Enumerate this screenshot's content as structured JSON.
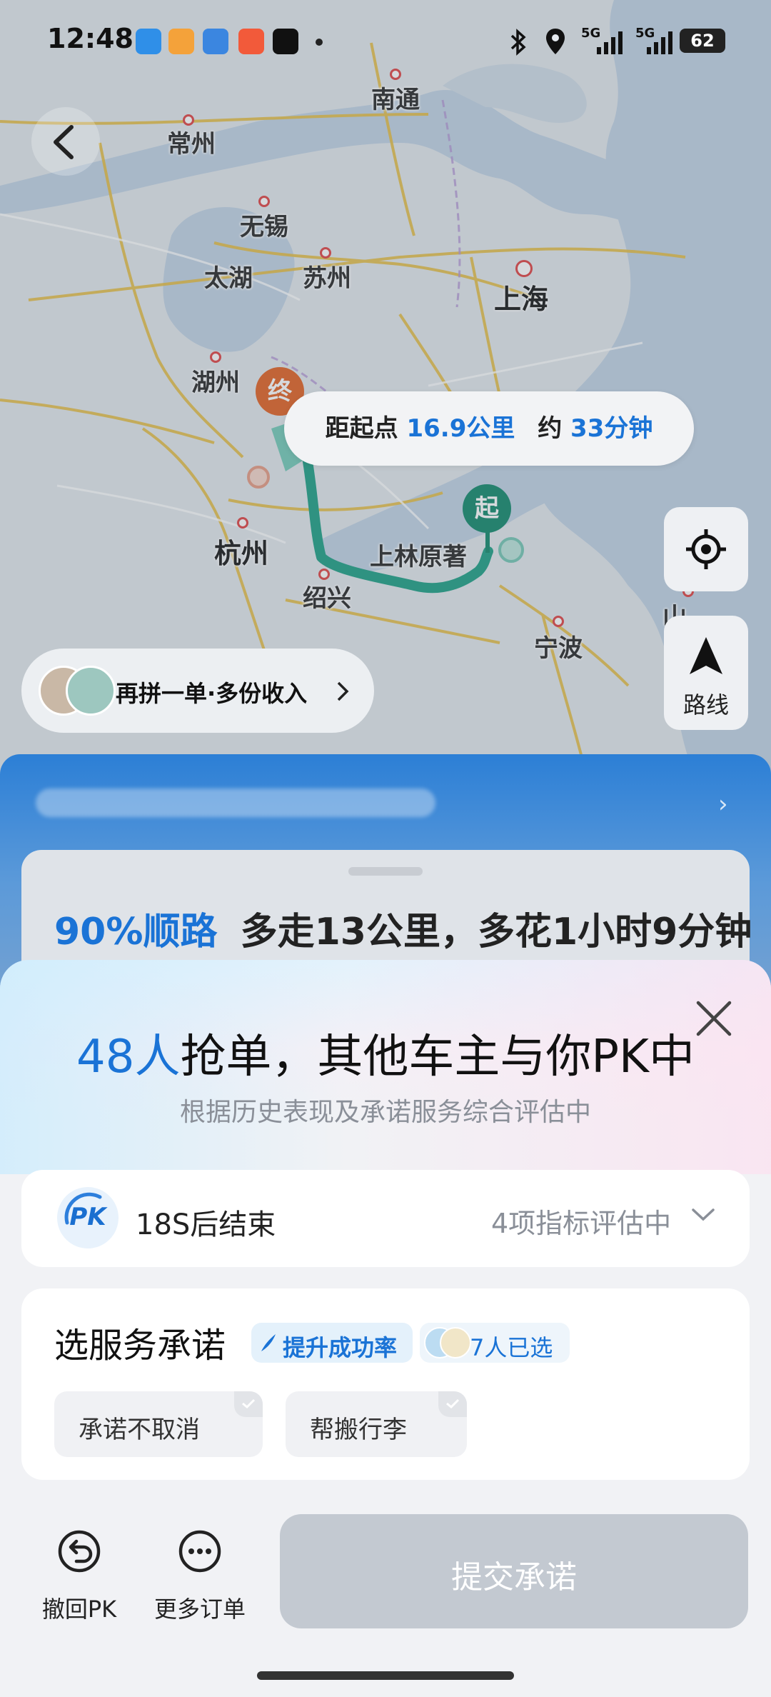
{
  "status_bar": {
    "time": "12:48",
    "signal_1": "5G",
    "signal_2": "5G",
    "battery": "62",
    "icons": [
      "app-icon-hitch",
      "app-icon-orange",
      "app-icon-cloud",
      "app-icon-red",
      "tiktok-icon",
      "bluetooth-icon",
      "location-icon"
    ]
  },
  "map": {
    "cities": {
      "nantong": "南通",
      "changzhou": "常州",
      "wuxi": "无锡",
      "taihu": "太湖",
      "suzhou": "苏州",
      "shanghai": "上海",
      "huzhou": "湖州",
      "hangzhou": "杭州",
      "shaoxing": "绍兴",
      "ningbo": "宁波",
      "origin_place": "上林原著",
      "edge_label": "山"
    },
    "end_marker": "终",
    "start_marker": "起",
    "distance": {
      "prefix": "距起点",
      "km": "16.9公里",
      "about": "约",
      "minutes": "33分钟"
    },
    "route_button_label": "路线",
    "carpool_label": "再拼一单·多份收入",
    "colors": {
      "route": "#2aa58b",
      "start": "#1e8f73",
      "end": "#e56a2e",
      "accent": "#1a73d6"
    }
  },
  "detour": {
    "percent": "90%顺路",
    "detail": "多走13公里，多花1小时9分钟"
  },
  "pk_sheet": {
    "count": "48人",
    "title_rest": "抢单，其他车主与你PK中",
    "subtitle": "根据历史表现及承诺服务综合评估中",
    "pk_badge": "PK",
    "timer": "18S后结束",
    "eval": "4项指标评估中",
    "promise_title": "选服务承诺",
    "boost_tag": "提升成功率",
    "selected_tag": "7人已选",
    "options": [
      "承诺不取消",
      "帮搬行李"
    ],
    "withdraw_label": "撤回PK",
    "more_label": "更多订单",
    "submit_label": "提交承诺"
  }
}
